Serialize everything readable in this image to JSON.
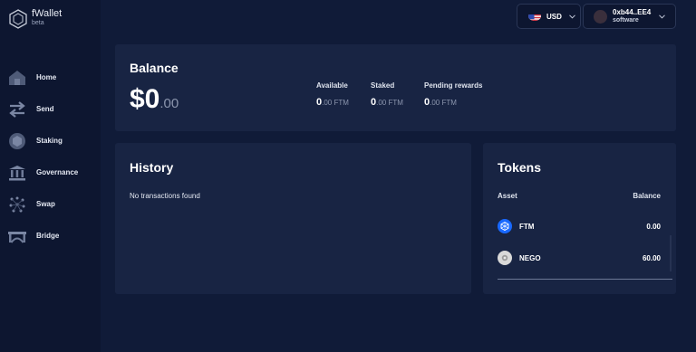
{
  "app": {
    "name": "fWallet",
    "tag": "beta"
  },
  "sidebar": {
    "items": [
      {
        "label": "Home",
        "icon": "home-icon"
      },
      {
        "label": "Send",
        "icon": "send-arrows-icon"
      },
      {
        "label": "Staking",
        "icon": "staking-icon"
      },
      {
        "label": "Governance",
        "icon": "governance-icon"
      },
      {
        "label": "Swap",
        "icon": "swap-icon"
      },
      {
        "label": "Bridge",
        "icon": "bridge-icon"
      }
    ]
  },
  "header": {
    "currency": {
      "label": "USD",
      "icon": "us-flag-icon"
    },
    "wallet": {
      "address": "0xb44..EE4",
      "type": "software"
    }
  },
  "balance": {
    "title": "Balance",
    "amount_int": "$0",
    "amount_dec": ".00",
    "stats": [
      {
        "label": "Available",
        "int": "0",
        "rest": ".00 FTM"
      },
      {
        "label": "Staked",
        "int": "0",
        "rest": ".00 FTM"
      },
      {
        "label": "Pending rewards",
        "int": "0",
        "rest": ".00 FTM"
      }
    ]
  },
  "history": {
    "title": "History",
    "empty_text": "No transactions found"
  },
  "tokens": {
    "title": "Tokens",
    "columns": {
      "asset": "Asset",
      "balance": "Balance"
    },
    "rows": [
      {
        "symbol": "FTM",
        "balance": "0.00",
        "icon": "ftm-token-icon",
        "color": "#1969ff"
      },
      {
        "symbol": "NEGO",
        "balance": "60.00",
        "icon": "nego-token-icon",
        "color": "#d9d9d9"
      }
    ]
  },
  "colors": {
    "background": "#101b38",
    "sidebar": "#0d1630",
    "card": "#182443",
    "muted": "#8c96ae"
  }
}
